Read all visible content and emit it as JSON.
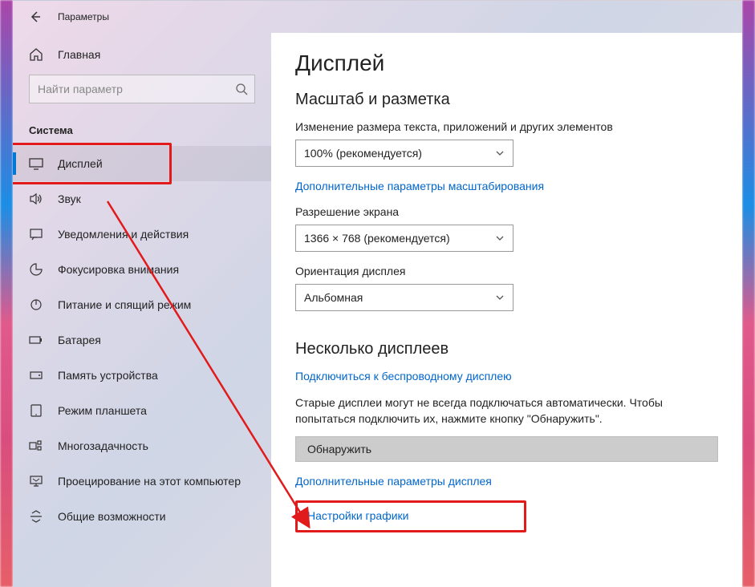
{
  "titlebar": {
    "label": "Параметры"
  },
  "sidebar": {
    "home_label": "Главная",
    "search_placeholder": "Найти параметр",
    "section_label": "Система",
    "items": [
      {
        "label": "Дисплей",
        "icon": "display-icon",
        "active": true
      },
      {
        "label": "Звук",
        "icon": "sound-icon",
        "active": false
      },
      {
        "label": "Уведомления и действия",
        "icon": "notifications-icon",
        "active": false
      },
      {
        "label": "Фокусировка внимания",
        "icon": "focus-icon",
        "active": false
      },
      {
        "label": "Питание и спящий режим",
        "icon": "power-icon",
        "active": false
      },
      {
        "label": "Батарея",
        "icon": "battery-icon",
        "active": false
      },
      {
        "label": "Память устройства",
        "icon": "storage-icon",
        "active": false
      },
      {
        "label": "Режим планшета",
        "icon": "tablet-icon",
        "active": false
      },
      {
        "label": "Многозадачность",
        "icon": "multitask-icon",
        "active": false
      },
      {
        "label": "Проецирование на этот компьютер",
        "icon": "project-icon",
        "active": false
      },
      {
        "label": "Общие возможности",
        "icon": "shared-icon",
        "active": false
      }
    ]
  },
  "main": {
    "page_title": "Дисплей",
    "scale_heading": "Масштаб и разметка",
    "scale_label": "Изменение размера текста, приложений и других элементов",
    "scale_value": "100% (рекомендуется)",
    "scale_link": "Дополнительные параметры масштабирования",
    "resolution_label": "Разрешение экрана",
    "resolution_value": "1366 × 768 (рекомендуется)",
    "orientation_label": "Ориентация дисплея",
    "orientation_value": "Альбомная",
    "multi_heading": "Несколько дисплеев",
    "wireless_link": "Подключиться к беспроводному дисплею",
    "detect_paragraph": "Старые дисплеи могут не всегда подключаться автоматически. Чтобы попытаться подключить их, нажмите кнопку \"Обнаружить\".",
    "detect_button": "Обнаружить",
    "advanced_link": "Дополнительные параметры дисплея",
    "graphics_link": "Настройки графики"
  }
}
